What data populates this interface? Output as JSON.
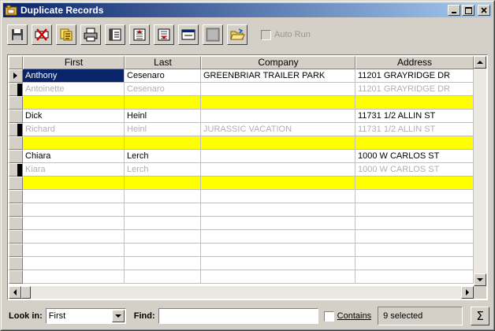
{
  "window": {
    "title": "Duplicate Records"
  },
  "toolbar": {
    "buttons": [
      {
        "icon": "save-icon"
      },
      {
        "icon": "delete-marked-icon"
      },
      {
        "icon": "copy-records-icon"
      },
      {
        "icon": "print-icon"
      },
      {
        "icon": "view-record-icon"
      },
      {
        "icon": "merge-up-icon"
      },
      {
        "icon": "merge-down-icon"
      },
      {
        "icon": "form-view-icon"
      },
      {
        "icon": "grid-view-icon"
      },
      {
        "icon": "open-folder-icon"
      }
    ],
    "auto_run_label": "Auto Run"
  },
  "grid": {
    "columns": [
      "First",
      "Last",
      "Company",
      "Address"
    ],
    "rows": [
      {
        "style": "current",
        "cells": [
          "Anthony",
          "Cesenaro",
          "GREENBRIAR TRAILER PARK",
          "11201 GRAYRIDGE DR"
        ]
      },
      {
        "style": "duplicate",
        "cells": [
          "Antoinette",
          "Cesenaro",
          "",
          "11201 GRAYRIDGE DR"
        ]
      },
      {
        "style": "separator",
        "cells": [
          "",
          "",
          "",
          ""
        ]
      },
      {
        "style": "normal",
        "cells": [
          "Dick",
          "Heinl",
          "",
          "11731 1/2 ALLIN ST"
        ]
      },
      {
        "style": "duplicate",
        "cells": [
          "Richard",
          "Heinl",
          "JURASSIC VACATION",
          "11731 1/2 ALLIN ST"
        ]
      },
      {
        "style": "separator",
        "cells": [
          "",
          "",
          "",
          ""
        ]
      },
      {
        "style": "normal",
        "cells": [
          "Chiara",
          "Lerch",
          "",
          "1000 W CARLOS ST"
        ]
      },
      {
        "style": "duplicate",
        "cells": [
          "Kiara",
          "Lerch",
          "",
          "1000 W CARLOS ST"
        ]
      },
      {
        "style": "separator",
        "cells": [
          "",
          "",
          "",
          ""
        ]
      },
      {
        "style": "empty",
        "cells": [
          "",
          "",
          "",
          ""
        ]
      },
      {
        "style": "empty",
        "cells": [
          "",
          "",
          "",
          ""
        ]
      },
      {
        "style": "empty",
        "cells": [
          "",
          "",
          "",
          ""
        ]
      },
      {
        "style": "empty",
        "cells": [
          "",
          "",
          "",
          ""
        ]
      },
      {
        "style": "empty",
        "cells": [
          "",
          "",
          "",
          ""
        ]
      },
      {
        "style": "empty",
        "cells": [
          "",
          "",
          "",
          ""
        ]
      },
      {
        "style": "empty",
        "cells": [
          "",
          "",
          "",
          ""
        ]
      }
    ]
  },
  "statusbar": {
    "look_in_label": "Look in:",
    "look_in_value": "First",
    "find_label": "Find:",
    "find_value": "",
    "contains_label": "Contains",
    "selected_text": "9 selected",
    "sum_button": "Σ"
  },
  "colors": {
    "separator": "#ffff00",
    "selection": "#0a246a",
    "duplicate_text": "#b0b0b0"
  }
}
